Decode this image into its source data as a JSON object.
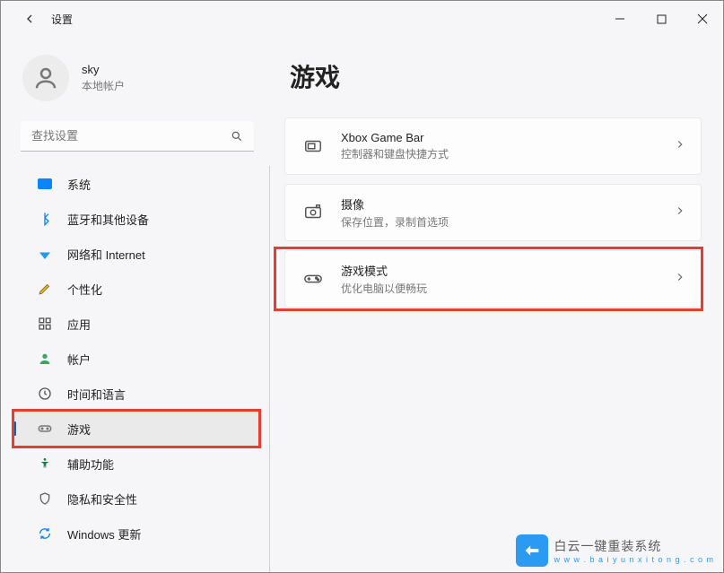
{
  "window": {
    "title": "设置"
  },
  "account": {
    "name": "sky",
    "subtitle": "本地帐户"
  },
  "search": {
    "placeholder": "查找设置"
  },
  "nav": {
    "items": [
      {
        "label": "系统"
      },
      {
        "label": "蓝牙和其他设备"
      },
      {
        "label": "网络和 Internet"
      },
      {
        "label": "个性化"
      },
      {
        "label": "应用"
      },
      {
        "label": "帐户"
      },
      {
        "label": "时间和语言"
      },
      {
        "label": "游戏"
      },
      {
        "label": "辅助功能"
      },
      {
        "label": "隐私和安全性"
      },
      {
        "label": "Windows 更新"
      }
    ]
  },
  "page": {
    "title": "游戏"
  },
  "cards": {
    "xbox": {
      "title": "Xbox Game Bar",
      "subtitle": "控制器和键盘快捷方式"
    },
    "capture": {
      "title": "摄像",
      "subtitle": "保存位置，录制首选项"
    },
    "gamemode": {
      "title": "游戏模式",
      "subtitle": "优化电脑以便畅玩"
    }
  },
  "watermark": {
    "line1": "白云一键重装系统",
    "line2": "w w w . b a i y u n x i t o n g . c o m"
  }
}
